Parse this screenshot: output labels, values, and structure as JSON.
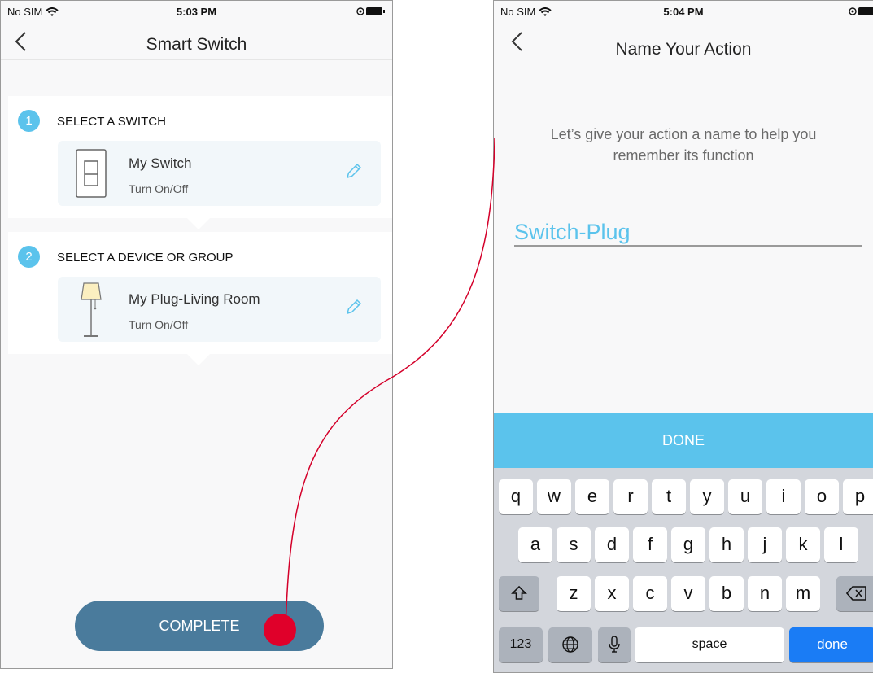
{
  "left_screen": {
    "status": {
      "carrier": "No SIM",
      "time": "5:03 PM"
    },
    "title": "Smart Switch",
    "steps": [
      {
        "number": "1",
        "label": "SELECT A SWITCH",
        "card": {
          "name": "My Switch",
          "action": "Turn On/Off"
        }
      },
      {
        "number": "2",
        "label": "SELECT A DEVICE OR GROUP",
        "card": {
          "name": "My Plug-Living Room",
          "action": "Turn On/Off"
        }
      }
    ],
    "complete_label": "COMPLETE"
  },
  "right_screen": {
    "status": {
      "carrier": "No SIM",
      "time": "5:04 PM"
    },
    "title": "Name Your Action",
    "prompt_line1": "Let’s give your action a name to help you",
    "prompt_line2": "remember its function",
    "name_value": "Switch-Plug",
    "done_bar_label": "DONE",
    "keyboard": {
      "row1": [
        "q",
        "w",
        "e",
        "r",
        "t",
        "y",
        "u",
        "i",
        "o",
        "p"
      ],
      "row2": [
        "a",
        "s",
        "d",
        "f",
        "g",
        "h",
        "j",
        "k",
        "l"
      ],
      "row3": [
        "z",
        "x",
        "c",
        "v",
        "b",
        "n",
        "m"
      ],
      "numbers_label": "123",
      "space_label": "space",
      "done_label": "done"
    }
  },
  "colors": {
    "accent": "#5bc3ec",
    "complete_button": "#4a7b9c",
    "annotation": "#e0002a",
    "keyboard_done": "#1a7cf5"
  },
  "icons": [
    "chevron-left-icon",
    "wifi-icon",
    "battery-icon",
    "light-switch-icon",
    "floor-lamp-icon",
    "pencil-icon",
    "shift-icon",
    "globe-icon",
    "microphone-icon",
    "backspace-icon"
  ]
}
